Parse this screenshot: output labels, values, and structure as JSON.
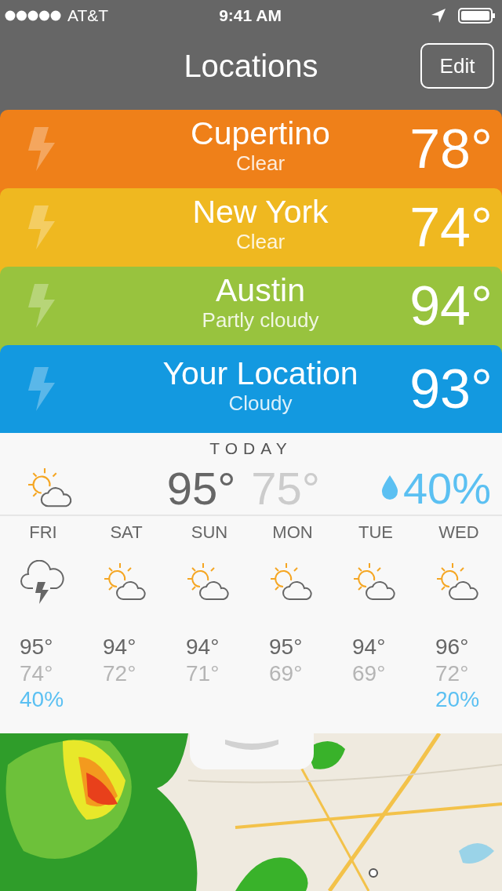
{
  "status_bar": {
    "carrier": "AT&T",
    "time": "9:41 AM"
  },
  "nav": {
    "title": "Locations",
    "edit_button": "Edit"
  },
  "locations": [
    {
      "city": "Cupertino",
      "condition": "Clear",
      "temperature": "78°",
      "color": "#ef8019"
    },
    {
      "city": "New York",
      "condition": "Clear",
      "temperature": "74°",
      "color": "#efb820"
    },
    {
      "city": "Austin",
      "condition": "Partly cloudy",
      "temperature": "94°",
      "color": "#98c33e"
    },
    {
      "city": "Your Location",
      "condition": "Cloudy",
      "temperature": "93°",
      "color": "#1399e0"
    }
  ],
  "today": {
    "heading": "TODAY",
    "kind": "partly-cloudy",
    "high": "95°",
    "low": "75°",
    "precip": "40%"
  },
  "forecast": [
    {
      "day": "FRI",
      "kind": "storm",
      "high": "95°",
      "low": "74°",
      "precip": "40%"
    },
    {
      "day": "SAT",
      "kind": "partly-cloudy",
      "high": "94°",
      "low": "72°"
    },
    {
      "day": "SUN",
      "kind": "partly-cloudy",
      "high": "94°",
      "low": "71°"
    },
    {
      "day": "MON",
      "kind": "partly-cloudy",
      "high": "95°",
      "low": "69°"
    },
    {
      "day": "TUE",
      "kind": "partly-cloudy",
      "high": "94°",
      "low": "69°"
    },
    {
      "day": "WED",
      "kind": "partly-cloudy",
      "high": "96°",
      "low": "72°",
      "precip": "20%"
    }
  ]
}
